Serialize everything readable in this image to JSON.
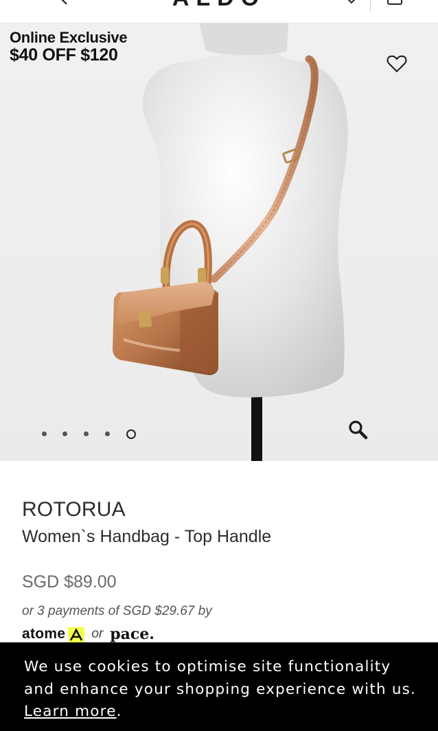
{
  "header": {
    "brand": "ALDO",
    "icons": [
      "chevron-left-icon",
      "shopping-bag-icon"
    ]
  },
  "hero": {
    "promo": {
      "line1": "Online Exclusive",
      "line2": "$40 OFF $120"
    },
    "icons": [
      "heart-icon",
      "search-icon"
    ],
    "carousel": {
      "slide_count": 5,
      "active_index": 4
    }
  },
  "product": {
    "name": "ROTORUA",
    "subtitle": "Women`s Handbag - Top Handle",
    "price": "SGD $89.00",
    "installments": "or 3 payments of SGD $29.67 by",
    "providers": {
      "atome": "atome",
      "or": "or",
      "pace": "pace."
    }
  },
  "cookie_banner": {
    "text": "We use cookies to optimise site functionality and enhance your shopping experience with us.",
    "link_label": "Learn more",
    "trailing": "."
  },
  "colors": {
    "background": "#ffffff",
    "hero_background": "#ededed",
    "banner_background": "#000000",
    "atome_accent": "#f4ff4d",
    "bag_tan": "#b8754a"
  }
}
